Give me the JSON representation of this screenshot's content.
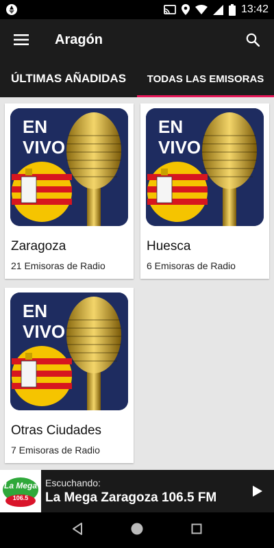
{
  "status_bar": {
    "time": "13:42",
    "icons": [
      "aperture-icon",
      "cast-icon",
      "location-icon",
      "wifi-icon",
      "signal-icon",
      "battery-icon"
    ]
  },
  "app_bar": {
    "title": "Aragón",
    "menu_icon": "hamburger-menu-icon",
    "search_icon": "search-icon"
  },
  "tabs": [
    {
      "label": "ÚLTIMAS AÑADIDAS",
      "active": false
    },
    {
      "label": "TODAS LAS EMISORAS",
      "active": true
    }
  ],
  "cards": [
    {
      "name": "Zaragoza",
      "count": "21 Emisoras de Radio",
      "badge_text": "EN VIVO"
    },
    {
      "name": "Huesca",
      "count": "6 Emisoras de Radio",
      "badge_text": "EN VIVO"
    },
    {
      "name": "Otras Ciudades",
      "count": "7 Emisoras de Radio",
      "badge_text": "EN VIVO"
    }
  ],
  "player": {
    "label": "Escuchando:",
    "station": "La Mega Zaragoza 106.5 FM",
    "logo_text": "La Mega",
    "logo_freq": "106.5",
    "play_icon": "play-icon"
  },
  "nav_bar": {
    "icons": [
      "back-icon",
      "home-icon",
      "recents-icon"
    ]
  },
  "colors": {
    "accent": "#e8185a",
    "app_bar": "#1c1c1c",
    "background": "#e6e6e6"
  }
}
